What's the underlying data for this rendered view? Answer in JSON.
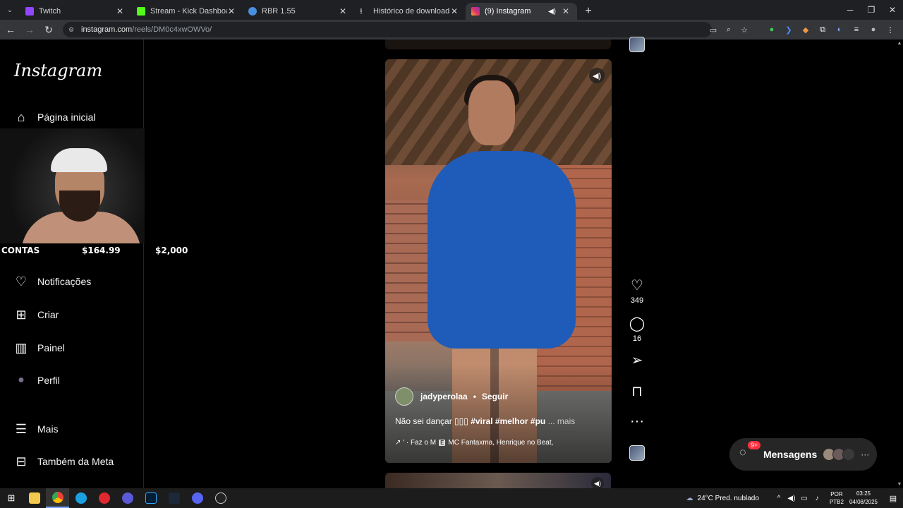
{
  "browser": {
    "tabs": [
      {
        "title": "Twitch",
        "color": "#9146ff"
      },
      {
        "title": "Stream - Kick Dashboard",
        "color": "#53fc18"
      },
      {
        "title": "RBR 1.55",
        "color": "#4a90e2"
      },
      {
        "title": "Histórico de downloads",
        "color": "#cfcfcf"
      },
      {
        "title": "(9) Instagram",
        "color": "#e1306c"
      }
    ],
    "url_host": "instagram.com",
    "url_path": "/reels/DM0c4xwOWVo/"
  },
  "instagram": {
    "logo": "Instagram",
    "nav": {
      "home": "Página inicial",
      "notifications": "Notificações",
      "create": "Criar",
      "dashboard": "Painel",
      "profile": "Perfil",
      "more": "Mais",
      "meta": "Também da Meta"
    },
    "reel": {
      "author": "jadyperolaa",
      "follow": "Seguir",
      "caption_text": "Não sei dançar ▯▯▯",
      "caption_tags": "#viral #melhor #pu",
      "caption_more": "... mais",
      "audio_prefix": "↗ ' · Faz o M",
      "audio_badge": "E",
      "audio_artists": "MC Fantaxma, Henrique no Beat,"
    },
    "actions": {
      "likes": "349",
      "comments": "16"
    },
    "messages": {
      "label": "Mensagens",
      "badge": "9+"
    }
  },
  "overlay": {
    "contas": "CONTAS",
    "amount1": "$164.99",
    "amount2": "$2,000"
  },
  "taskbar": {
    "weather": "24°C  Pred. nublado",
    "lang_top": "POR",
    "lang_bottom": "PTB2",
    "time": "03:25",
    "date": "04/08/2025"
  }
}
